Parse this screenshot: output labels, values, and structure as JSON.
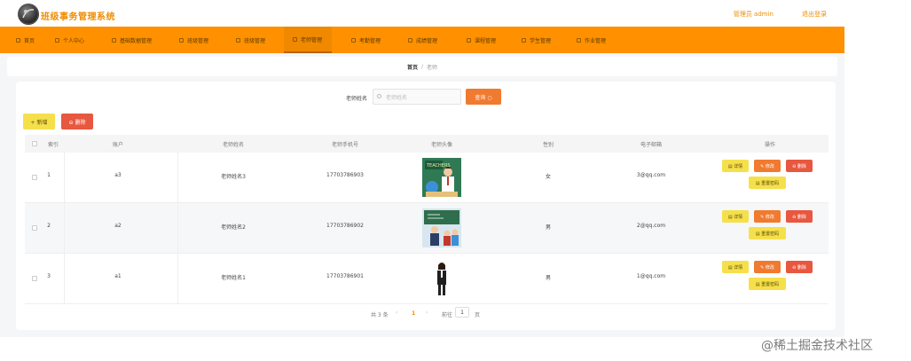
{
  "app": {
    "title": "班级事务管理系统",
    "user_label": "管理员 admin",
    "logout_label": "退出登录"
  },
  "nav": [
    {
      "label": "首页"
    },
    {
      "label": "个人中心"
    },
    {
      "label": "基础数据管理"
    },
    {
      "label": "班级管理"
    },
    {
      "label": "班级管理"
    },
    {
      "label": "老师管理"
    },
    {
      "label": "考勤管理"
    },
    {
      "label": "成绩管理"
    },
    {
      "label": "课程管理"
    },
    {
      "label": "学生管理"
    },
    {
      "label": "作业管理"
    }
  ],
  "breadcrumb": {
    "home": "首页",
    "separator": "/",
    "current": "老师"
  },
  "search": {
    "label": "老师姓名",
    "placeholder": "老师姓名",
    "button_label": "查询 ○"
  },
  "toolbar": {
    "add_label": "+ 新增",
    "delete_label": "⊖ 删除"
  },
  "table": {
    "headers": [
      "索引",
      "账户",
      "老师姓名",
      "老师手机号",
      "老师头像",
      "性别",
      "电子邮箱",
      "操作"
    ],
    "rows": [
      {
        "index": "1",
        "account": "a3",
        "name": "老师姓名3",
        "phone": "17703786903",
        "gender": "女",
        "email": "3@qq.com",
        "photo": "classroom-teacher"
      },
      {
        "index": "2",
        "account": "a2",
        "name": "老师姓名2",
        "phone": "17703786902",
        "gender": "男",
        "email": "2@qq.com",
        "photo": "classroom-board"
      },
      {
        "index": "3",
        "account": "a1",
        "name": "老师姓名1",
        "phone": "17703786901",
        "gender": "男",
        "email": "1@qq.com",
        "photo": "standing-teacher"
      }
    ],
    "actions": {
      "detail": "▤ 详情",
      "edit": "✎ 修改",
      "remove": "⊖ 删除",
      "reset": "▤ 重置密码"
    }
  },
  "pagination": {
    "total": "共 3 条",
    "prev": "‹",
    "page": "1",
    "next": "›",
    "goto": "前往",
    "goto_value": "1",
    "unit": "页"
  },
  "watermark": "@稀土掘金技术社区",
  "colors": {
    "nav": "#ff9000",
    "accent": "#f08c00",
    "yellow": "#f5e04c",
    "orange": "#f07a30",
    "red": "#e8573f"
  }
}
